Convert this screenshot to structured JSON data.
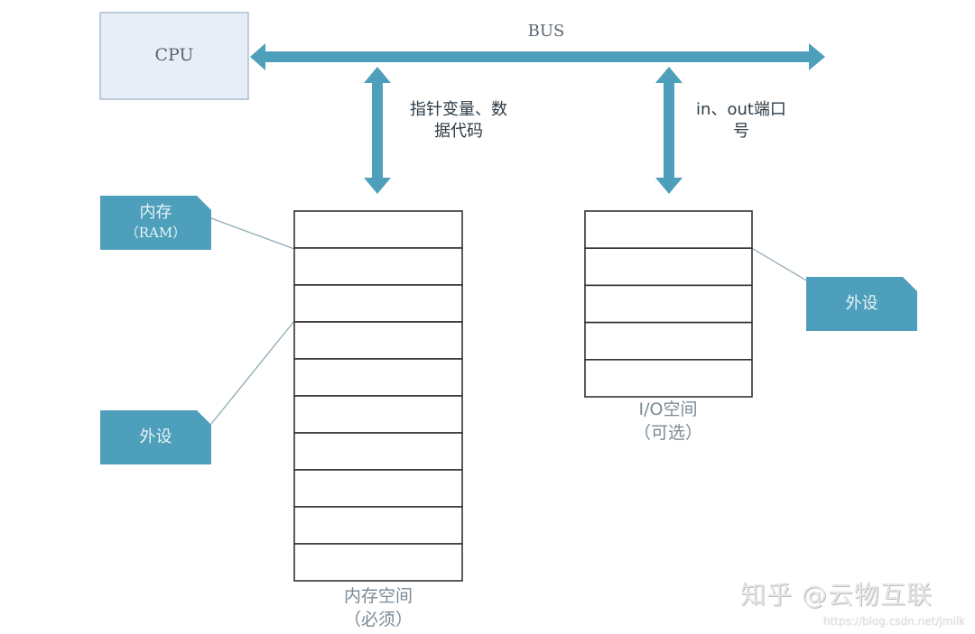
{
  "colors": {
    "accent": "#4e9fbb",
    "cpu_fill": "#e7eef8",
    "cpu_border": "#a9bdd3",
    "cell_border": "#333333",
    "leader_line": "#8fa9b5"
  },
  "cpu": {
    "label": "CPU"
  },
  "bus": {
    "label": "BUS"
  },
  "links": {
    "memory": {
      "line1": "指针变量、数",
      "line2": "据代码"
    },
    "io": {
      "line1": "in、out端口",
      "line2": "号"
    }
  },
  "tags": {
    "ram": {
      "line1": "内存",
      "line2": "（RAM）"
    },
    "left_peripheral": {
      "label": "外设"
    },
    "right_peripheral": {
      "label": "外设"
    }
  },
  "memory_space": {
    "rows": 10,
    "caption_line1": "内存空间",
    "caption_line2": "（必须）"
  },
  "io_space": {
    "rows": 5,
    "caption_line1": "I/O空间",
    "caption_line2": "（可选）"
  },
  "watermark": {
    "main": "知乎 @云物互联",
    "url": "https://blog.csdn.net/Jmilk"
  }
}
